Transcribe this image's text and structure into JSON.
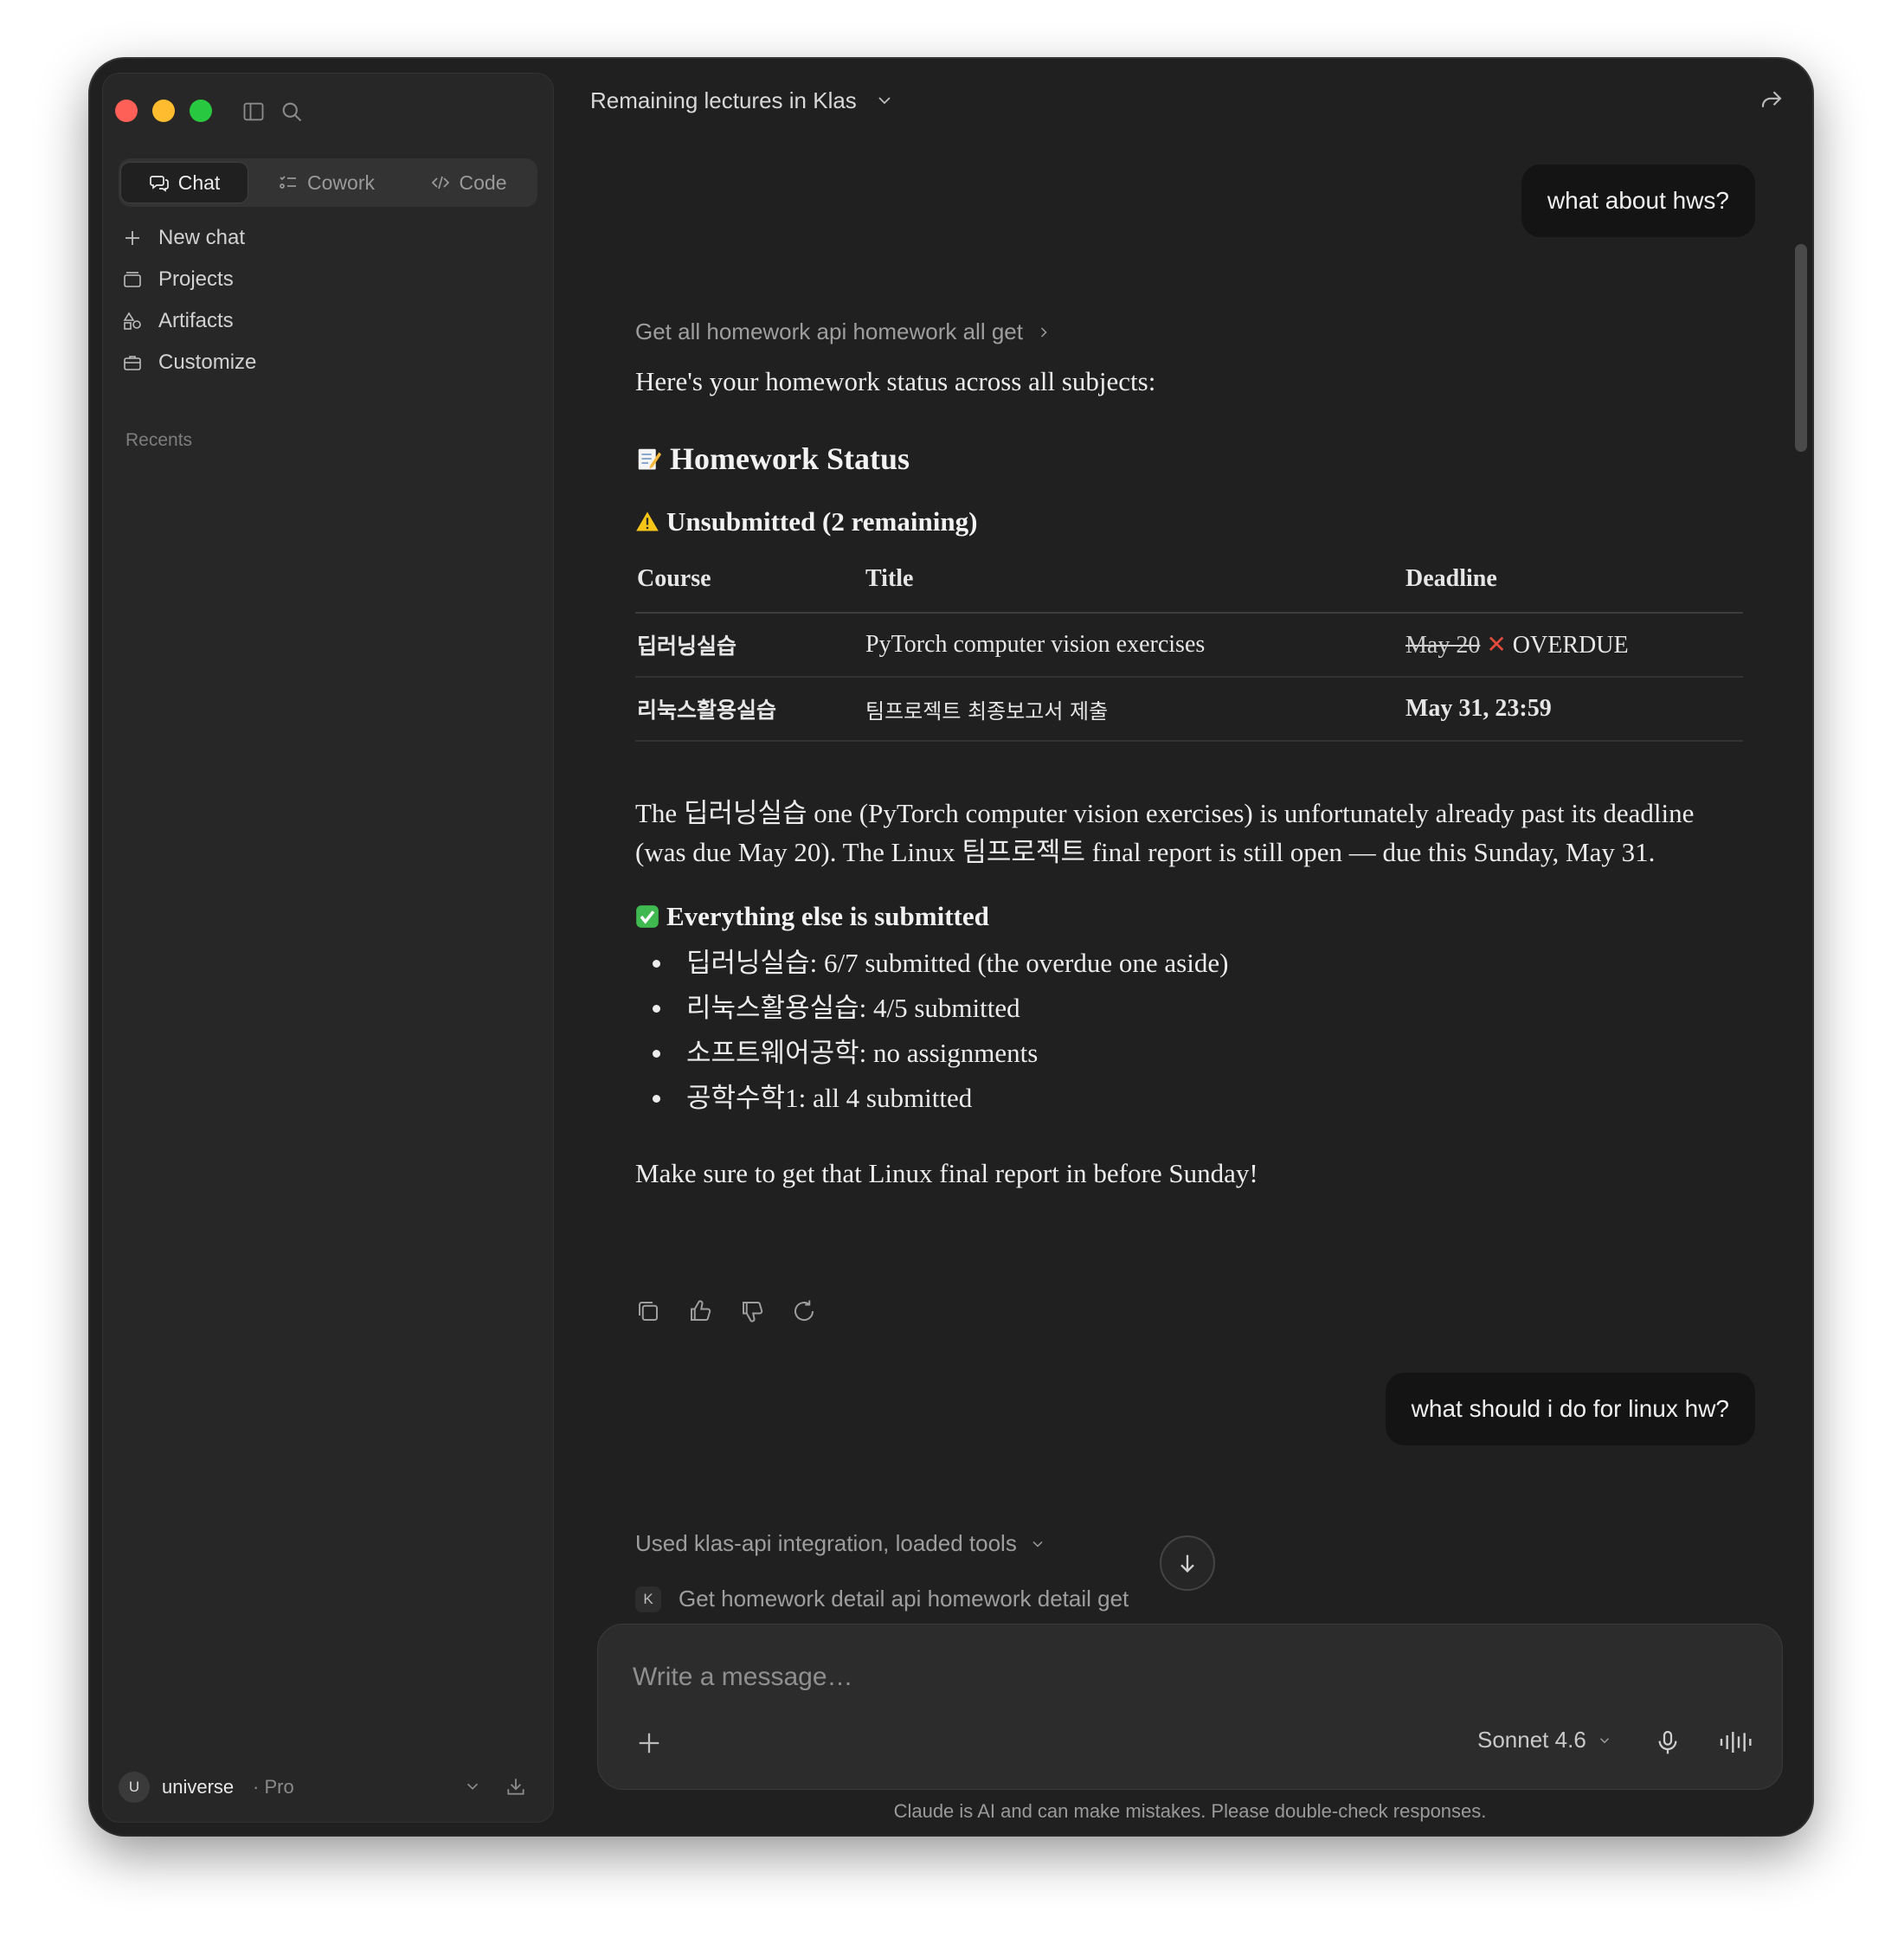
{
  "sidebar": {
    "tabs": [
      {
        "label": "Chat",
        "icon": "chat-bubbles-icon",
        "active": true
      },
      {
        "label": "Cowork",
        "icon": "checklist-icon",
        "active": false
      },
      {
        "label": "Code",
        "icon": "code-brackets-icon",
        "active": false
      }
    ],
    "nav": [
      {
        "label": "New chat",
        "icon": "plus-icon"
      },
      {
        "label": "Projects",
        "icon": "folder-icon"
      },
      {
        "label": "Artifacts",
        "icon": "shapes-icon"
      },
      {
        "label": "Customize",
        "icon": "briefcase-icon"
      }
    ],
    "recents_label": "Recents",
    "user": {
      "initial": "U",
      "name": "universe",
      "plan": "· Pro"
    }
  },
  "header": {
    "title": "Remaining lectures in Klas"
  },
  "messages": {
    "user1": "what about hws?",
    "tool1": "Get all homework api homework all get",
    "intro": "Here's your homework status across all subjects:",
    "heading": "Homework Status",
    "unsubmitted_heading": "Unsubmitted (2 remaining)",
    "table": {
      "headers": [
        "Course",
        "Title",
        "Deadline"
      ],
      "rows": [
        {
          "course": "딥러닝실습",
          "title": "PyTorch computer vision exercises",
          "deadline_struck": "May 20",
          "deadline_flag": "✕",
          "deadline_status": "OVERDUE"
        },
        {
          "course": "리눅스활용실습",
          "title": "팀프로젝트 최종보고서 제출",
          "deadline": "May 31, 23:59"
        }
      ]
    },
    "summary": "The 딥러닝실습 one (PyTorch computer vision exercises) is unfortunately already past its deadline (was due May 20). The Linux 팀프로젝트 final report is still open — due this Sunday, May 31.",
    "submitted_heading": "Everything else is submitted",
    "bullets": [
      "딥러닝실습: 6/7 submitted (the overdue one aside)",
      "리눅스활용실습: 4/5 submitted",
      "소프트웨어공학: no assignments",
      "공학수학1: all 4 submitted"
    ],
    "closing": "Make sure to get that Linux final report in before Sunday!",
    "user2": "what should i do for linux hw?",
    "tool2": "Used klas-api integration, loaded tools",
    "tool3_badge": "K",
    "tool3": "Get homework detail api homework detail get"
  },
  "composer": {
    "placeholder": "Write a message…",
    "model": "Sonnet 4.6"
  },
  "disclaimer": "Claude is AI and can make mistakes. Please double-check responses.",
  "colors": {
    "window_bg": "#202020",
    "sidebar_bg": "#272727",
    "bubble_bg": "#141414",
    "overdue_red": "#e14b3c",
    "warning_yellow": "#f5c518",
    "check_green": "#3fb950"
  }
}
